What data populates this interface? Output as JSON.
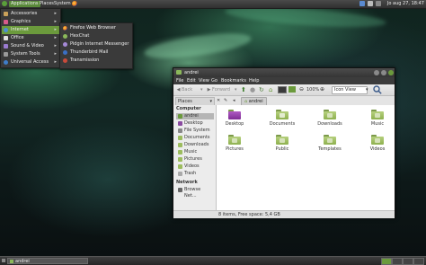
{
  "top_panel": {
    "applications": "Applications",
    "places": "Places",
    "system": "System",
    "clock": "Jo aug 27, 18:47"
  },
  "app_menu": {
    "items": [
      {
        "label": "Accessories",
        "icon": "accessories-icon"
      },
      {
        "label": "Graphics",
        "icon": "graphics-icon"
      },
      {
        "label": "Internet",
        "icon": "internet-icon"
      },
      {
        "label": "Office",
        "icon": "office-icon"
      },
      {
        "label": "Sound & Video",
        "icon": "sound-video-icon"
      },
      {
        "label": "System Tools",
        "icon": "system-tools-icon"
      },
      {
        "label": "Universal Access",
        "icon": "universal-access-icon"
      }
    ],
    "active": "Internet"
  },
  "internet_submenu": {
    "items": [
      {
        "label": "Firefox Web Browser",
        "icon": "firefox-icon"
      },
      {
        "label": "HexChat",
        "icon": "hexchat-icon"
      },
      {
        "label": "Pidgin Internet Messenger",
        "icon": "pidgin-icon"
      },
      {
        "label": "Thunderbird Mail",
        "icon": "thunderbird-icon"
      },
      {
        "label": "Transmission",
        "icon": "transmission-icon"
      }
    ]
  },
  "window": {
    "title": "andrei",
    "menus": [
      "File",
      "Edit",
      "View",
      "Go",
      "Bookmarks",
      "Help"
    ],
    "toolbar": {
      "back": "Back",
      "forward": "Forward",
      "zoom": "100%",
      "view_mode": "Icon View"
    },
    "location": {
      "sidebar_mode": "Places",
      "crumb": "andrei"
    },
    "sidebar": {
      "sections": [
        {
          "heading": "Computer",
          "items": [
            {
              "label": "andrei",
              "icon": "home-icon",
              "selected": true
            },
            {
              "label": "Desktop",
              "icon": "desktop-icon"
            },
            {
              "label": "File System",
              "icon": "drive-icon"
            },
            {
              "label": "Documents",
              "icon": "folder-icon"
            },
            {
              "label": "Downloads",
              "icon": "folder-icon"
            },
            {
              "label": "Music",
              "icon": "folder-icon"
            },
            {
              "label": "Pictures",
              "icon": "folder-icon"
            },
            {
              "label": "Videos",
              "icon": "folder-icon"
            },
            {
              "label": "Trash",
              "icon": "trash-icon"
            }
          ]
        },
        {
          "heading": "Network",
          "items": [
            {
              "label": "Browse Net...",
              "icon": "network-icon"
            }
          ]
        }
      ]
    },
    "files": [
      {
        "name": "Desktop",
        "emblem": "#a23bb0"
      },
      {
        "name": "Documents",
        "emblem": "#ffffff"
      },
      {
        "name": "Downloads",
        "emblem": "#ffffff"
      },
      {
        "name": "Music",
        "emblem": "#ffffff"
      },
      {
        "name": "Pictures",
        "emblem": "#ffffff"
      },
      {
        "name": "Public",
        "emblem": "#ffffff"
      },
      {
        "name": "Templates",
        "emblem": "#ffffff"
      },
      {
        "name": "Videos",
        "emblem": "#ffffff"
      }
    ],
    "status": "8 items, Free space: 5,4 GB"
  },
  "bottom_panel": {
    "task": "andrei"
  },
  "colors": {
    "accent": "#6b9a3c",
    "folder": "#9cbc5e",
    "panel": "#333333"
  }
}
